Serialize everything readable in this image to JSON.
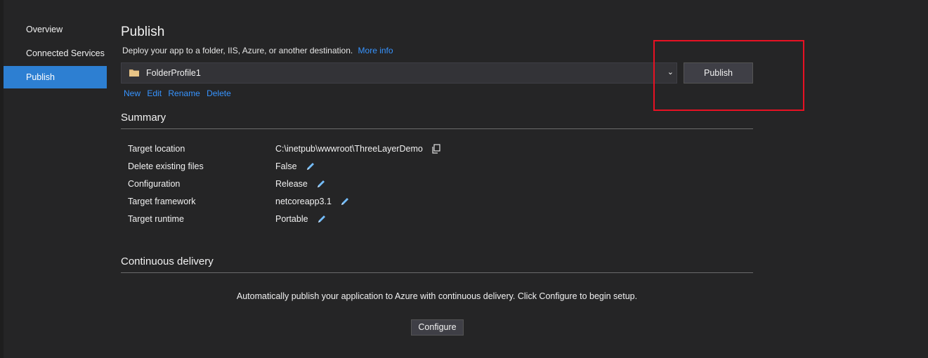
{
  "nav": {
    "items": [
      {
        "label": "Overview",
        "active": false
      },
      {
        "label": "Connected Services",
        "active": false
      },
      {
        "label": "Publish",
        "active": true
      }
    ]
  },
  "header": {
    "title": "Publish",
    "subtitle": "Deploy your app to a folder, IIS, Azure, or another destination.",
    "more_info": "More info"
  },
  "profile": {
    "selected": "FolderProfile1",
    "publish_label": "Publish",
    "actions": [
      "New",
      "Edit",
      "Rename",
      "Delete"
    ]
  },
  "summary": {
    "title": "Summary",
    "rows": [
      {
        "key": "Target location",
        "value": "C:\\inetpub\\wwwroot\\ThreeLayerDemo",
        "icon": "copy-icon"
      },
      {
        "key": "Delete existing files",
        "value": "False",
        "icon": "edit-icon"
      },
      {
        "key": "Configuration",
        "value": "Release",
        "icon": "edit-icon"
      },
      {
        "key": "Target framework",
        "value": "netcoreapp3.1",
        "icon": "edit-icon"
      },
      {
        "key": "Target runtime",
        "value": "Portable",
        "icon": "edit-icon"
      }
    ]
  },
  "continuous_delivery": {
    "title": "Continuous delivery",
    "description": "Automatically publish your application to Azure with continuous delivery. Click Configure to begin setup.",
    "configure_label": "Configure"
  },
  "colors": {
    "background": "#252526",
    "accent": "#2d7fd2",
    "link": "#3794ff",
    "highlight": "#e81123"
  }
}
